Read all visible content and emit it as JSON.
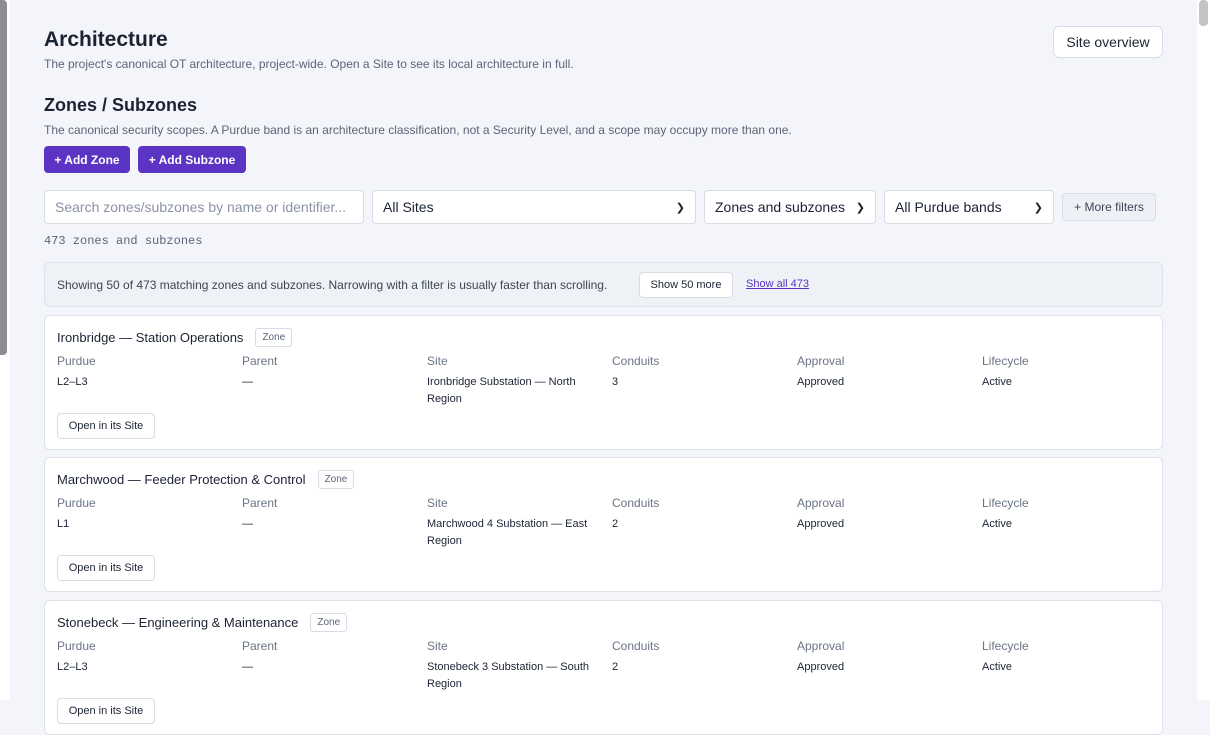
{
  "page": {
    "title": "Architecture",
    "subtitle": "The project's canonical OT architecture, project-wide. Open a Site to see its local architecture in full.",
    "overview_button": "Site overview"
  },
  "zones": {
    "heading": "Zones / Subzones",
    "description": "The canonical security scopes. A Purdue band is an architecture classification, not a Security Level, and a scope may occupy more than one.",
    "add_zone_label": "+ Add Zone",
    "add_subzone_label": "+ Add Subzone"
  },
  "filters": {
    "search_placeholder": "Search zones/subzones by name or identifier...",
    "site_selected": "All Sites",
    "kind_selected": "Zones and subzones",
    "purdue_selected": "All Purdue bands",
    "more_filters_label": "+ More filters"
  },
  "result_count": "473 zones and subzones",
  "notice": {
    "text": "Showing 50 of 473 matching zones and subzones. Narrowing with a filter is usually faster than scrolling.",
    "show_more_label": "Show 50 more",
    "show_all_label": "Show all 473"
  },
  "field_labels": {
    "purdue": "Purdue",
    "parent": "Parent",
    "site": "Site",
    "conduits": "Conduits",
    "approval": "Approval",
    "lifecycle": "Lifecycle"
  },
  "open_button_label": "Open in its Site",
  "cards": [
    {
      "name": "Ironbridge — Station Operations",
      "badge": "Zone",
      "purdue": "L2–L3",
      "parent": "—",
      "site": "Ironbridge Substation — North Region",
      "conduits": "3",
      "approval": "Approved",
      "lifecycle": "Active"
    },
    {
      "name": "Marchwood — Feeder Protection & Control",
      "badge": "Zone",
      "purdue": "L1",
      "parent": "—",
      "site": "Marchwood 4 Substation — East Region",
      "conduits": "2",
      "approval": "Approved",
      "lifecycle": "Active"
    },
    {
      "name": "Stonebeck — Engineering & Maintenance",
      "badge": "Zone",
      "purdue": "L2–L3",
      "parent": "—",
      "site": "Stonebeck 3 Substation — South Region",
      "conduits": "2",
      "approval": "Approved",
      "lifecycle": "Active"
    }
  ]
}
